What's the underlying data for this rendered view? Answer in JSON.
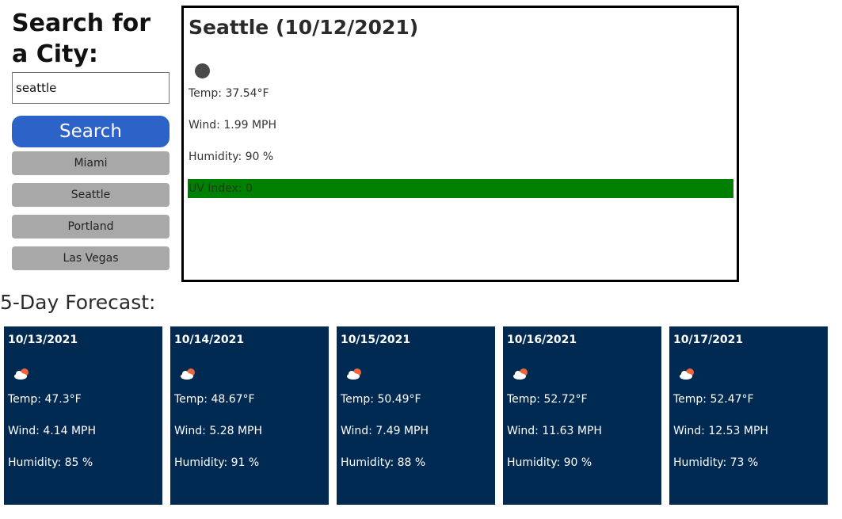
{
  "search": {
    "heading": "Search for a City:",
    "input_value": "seattle",
    "button_label": "Search",
    "history": [
      "Miami",
      "Seattle",
      "Portland",
      "Las Vegas"
    ]
  },
  "current": {
    "title": "Seattle (10/12/2021)",
    "icon": "moon-circle-icon",
    "temp": "Temp: 37.54°F",
    "wind": "Wind: 1.99 MPH",
    "humidity": "Humidity: 90 %",
    "uv": "UV Index: 0",
    "uv_color": "#008000"
  },
  "forecast": {
    "heading": "5-Day Forecast:",
    "card_color": "#012a52",
    "days": [
      {
        "date": "10/13/2021",
        "icon": "cloud-sun-icon",
        "temp": "Temp: 47.3°F",
        "wind": "Wind: 4.14 MPH",
        "humidity": "Humidity: 85 %"
      },
      {
        "date": "10/14/2021",
        "icon": "cloud-sun-icon",
        "temp": "Temp: 48.67°F",
        "wind": "Wind: 5.28 MPH",
        "humidity": "Humidity: 91 %"
      },
      {
        "date": "10/15/2021",
        "icon": "cloud-sun-icon",
        "temp": "Temp: 50.49°F",
        "wind": "Wind: 7.49 MPH",
        "humidity": "Humidity: 88 %"
      },
      {
        "date": "10/16/2021",
        "icon": "cloud-sun-icon",
        "temp": "Temp: 52.72°F",
        "wind": "Wind: 11.63 MPH",
        "humidity": "Humidity: 90 %"
      },
      {
        "date": "10/17/2021",
        "icon": "cloud-sun-icon",
        "temp": "Temp: 52.47°F",
        "wind": "Wind: 12.53 MPH",
        "humidity": "Humidity: 73 %"
      }
    ]
  }
}
